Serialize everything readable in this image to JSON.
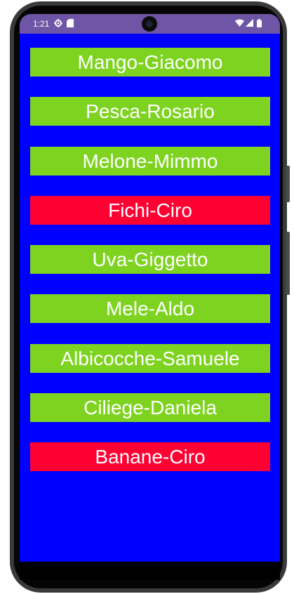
{
  "status_bar": {
    "time": "1:21",
    "icons_left": [
      "settings-gear-icon",
      "sd-card-icon"
    ],
    "icons_right": [
      "wifi-icon",
      "cell-signal-icon",
      "battery-icon"
    ],
    "color": "#6f55a5"
  },
  "screen": {
    "background": "#0000ff"
  },
  "items": [
    {
      "label": "Mango-Giacomo",
      "color": "#7ed321"
    },
    {
      "label": "Pesca-Rosario",
      "color": "#7ed321"
    },
    {
      "label": "Melone-Mimmo",
      "color": "#7ed321"
    },
    {
      "label": "Fichi-Ciro",
      "color": "#ff0033"
    },
    {
      "label": "Uva-Giggetto",
      "color": "#7ed321"
    },
    {
      "label": "Mele-Aldo",
      "color": "#7ed321"
    },
    {
      "label": "Albicocche-Samuele",
      "color": "#7ed321"
    },
    {
      "label": "Ciliege-Daniela",
      "color": "#7ed321"
    },
    {
      "label": "Banane-Ciro",
      "color": "#ff0033"
    }
  ]
}
